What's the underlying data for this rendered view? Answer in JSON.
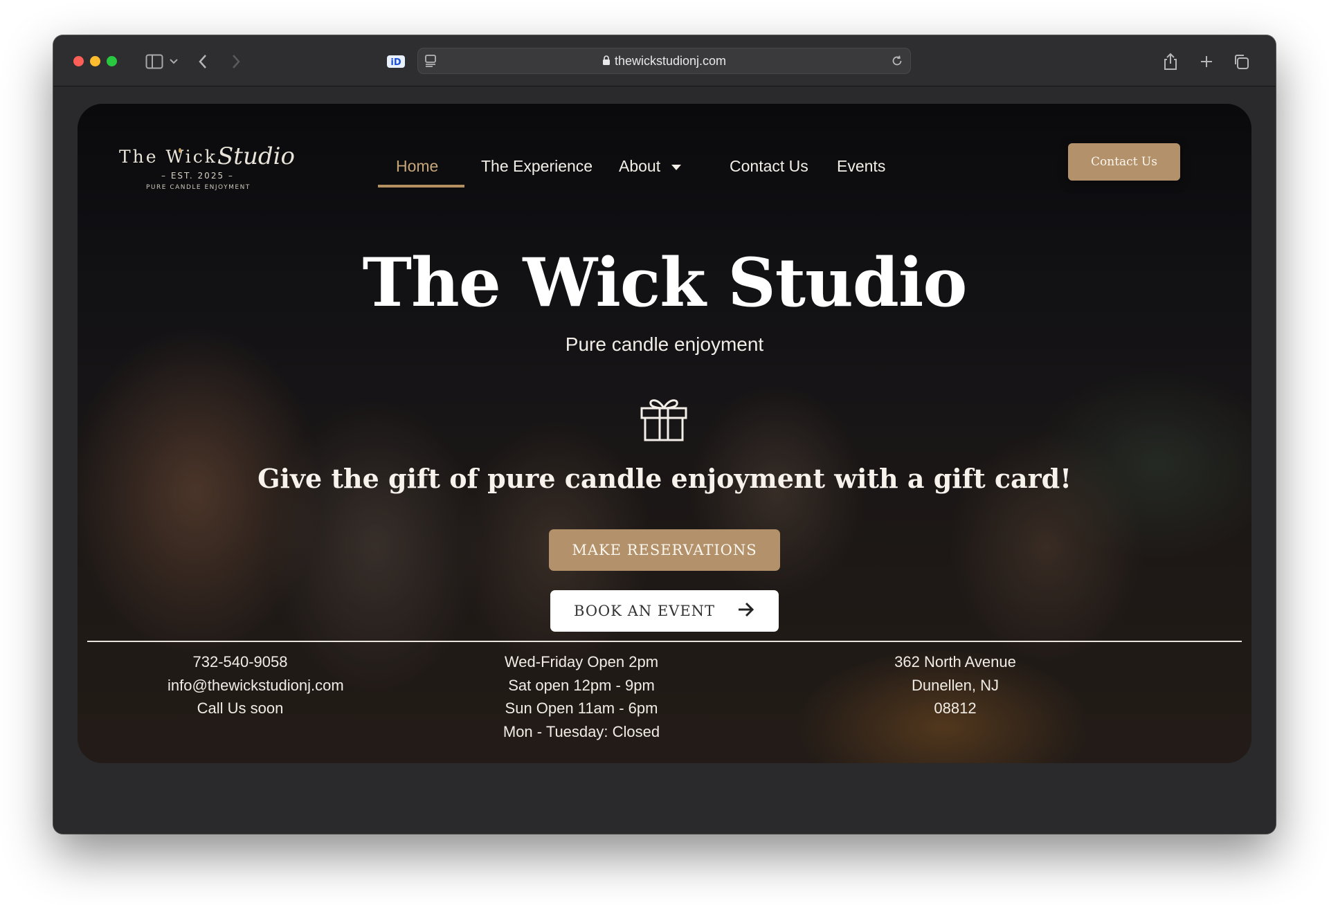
{
  "browser": {
    "url": "thewickstudionj.com"
  },
  "logo": {
    "main": "The Wick",
    "script": "Studio",
    "est": "– EST. 2025 –",
    "tagline": "PURE CANDLE ENJOYMENT"
  },
  "nav": {
    "items": [
      {
        "label": "Home"
      },
      {
        "label": "The Experience"
      },
      {
        "label": "About"
      },
      {
        "label": "Contact Us"
      },
      {
        "label": "Events"
      }
    ],
    "cta": "Contact Us"
  },
  "hero": {
    "title": "The Wick Studio",
    "subtitle": "Pure candle enjoyment",
    "gift_text": "Give the gift of pure candle enjoyment with a gift card!",
    "reserve_button": "MAKE RESERVATIONS",
    "book_button": "BOOK AN EVENT"
  },
  "info": {
    "contact": [
      "732-540-9058",
      "info@thewickstudionj.com",
      "Call Us soon"
    ],
    "hours": [
      "Wed-Friday Open 2pm",
      "Sat open 12pm - 9pm",
      "Sun Open 11am - 6pm",
      "Mon - Tuesday: Closed"
    ],
    "address": [
      "362 North Avenue",
      "Dunellen, NJ",
      "08812"
    ]
  },
  "colors": {
    "accent": "#b3916a",
    "nav_active": "#c7a77a"
  }
}
